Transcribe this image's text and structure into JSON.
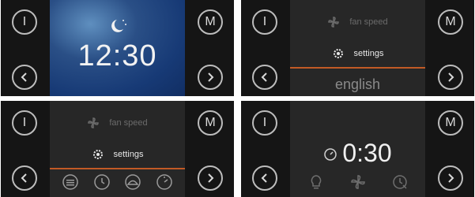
{
  "buttons": {
    "power": "I",
    "mode": "M"
  },
  "panel1": {
    "time": "12:30",
    "moon_icon": "moon-stars-icon"
  },
  "panel2": {
    "fan_label": "fan speed",
    "settings_label": "settings",
    "language_value": "english"
  },
  "panel3": {
    "fan_label": "fan speed",
    "settings_label": "settings",
    "options": [
      "display-icon",
      "clock-icon",
      "dome-icon",
      "timer-icon"
    ]
  },
  "panel4": {
    "timer_value": "0:30",
    "icons": [
      "bulb-icon",
      "fan-icon",
      "clock-off-icon"
    ]
  },
  "colors": {
    "accent": "#c25a25",
    "screen_blue": "#173a76",
    "screen_dark": "#272727"
  }
}
